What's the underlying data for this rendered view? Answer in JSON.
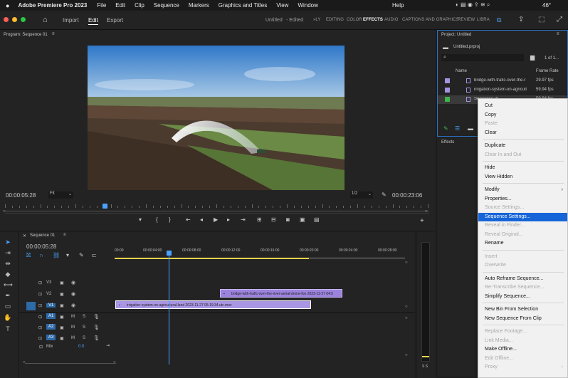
{
  "menubar": {
    "app": "Adobe Premiere Pro 2023",
    "items": [
      "File",
      "Edit",
      "Clip",
      "Sequence",
      "Markers",
      "Graphics and Titles",
      "View",
      "Window"
    ],
    "help": "Help",
    "battery": "46°"
  },
  "appbar": {
    "tabs": [
      "Import",
      "Edit",
      "Export"
    ],
    "active_tab": "Edit",
    "title": "Untitled",
    "edited": "- Edited",
    "workspaces": [
      "»LY",
      "EDITING",
      "COLOR",
      "EFFECTS",
      "AUDIO",
      "CAPTIONS AND GRAPHICS",
      "REVIEW",
      "LIBRA"
    ],
    "active_workspace": "EFFECTS"
  },
  "program": {
    "title": "Program: Sequence 01",
    "timecode_left": "00:00:05:28",
    "fit": "Fit",
    "resolution": "1/2",
    "timecode_right": "00:00:23:06",
    "playhead_fraction": 0.235
  },
  "project": {
    "title": "Project: Untitled",
    "file": "Untitled.prproj",
    "count": "1 of 1...",
    "col_name": "Name",
    "col_rate": "Frame Rate",
    "items": [
      {
        "name": "bridge-with-trafic-over-the-r",
        "rate": "29.97 fps",
        "color": "#a592e0"
      },
      {
        "name": "irrigation-system-on-agricult",
        "rate": "59.94 fps",
        "color": "#a592e0"
      },
      {
        "name": "Sequence 01",
        "rate": "59.94 fps",
        "color": "#3fb54b"
      }
    ]
  },
  "effects": {
    "title": "Effects"
  },
  "timeline": {
    "title": "Sequence 01",
    "timecode": "00:00:05:28",
    "ruler": [
      "00:00",
      "00:00:04:00",
      "00:00:08:00",
      "00:00:12:00",
      "00:00:16:00",
      "00:00:20:00",
      "00:00:24:00",
      "00:00:28:00"
    ],
    "video_tracks": [
      "V3",
      "V2",
      "V1"
    ],
    "audio_tracks": [
      "A1",
      "A2",
      "A3"
    ],
    "mix_label": "Mix",
    "mix_value": "0.0",
    "clip_v2": "bridge-with-trafic-over-the-river-aerial-drone-foo 2023-11-27 04:5",
    "clip_v1": "irrigation-system-on-agricultural-land 2023-11-27 05:19:34.utc.mov"
  },
  "meter": {
    "label": "S S"
  },
  "context_menu": {
    "items": [
      {
        "label": "Cut",
        "disabled": false
      },
      {
        "label": "Copy",
        "disabled": false
      },
      {
        "label": "Paste",
        "disabled": true
      },
      {
        "label": "Clear",
        "disabled": false
      },
      {
        "label": "Duplicate",
        "disabled": false
      },
      {
        "label": "Clear In and Out",
        "disabled": true
      },
      {
        "label": "Hide",
        "disabled": false
      },
      {
        "label": "View Hidden",
        "disabled": false
      },
      {
        "label": "Modify",
        "disabled": false,
        "submenu": true
      },
      {
        "label": "Properties...",
        "disabled": false
      },
      {
        "label": "Source Settings...",
        "disabled": true
      },
      {
        "label": "Sequence Settings...",
        "disabled": false,
        "highlighted": true
      },
      {
        "label": "Reveal in Finder...",
        "disabled": true
      },
      {
        "label": "Reveal Original...",
        "disabled": true
      },
      {
        "label": "Rename",
        "disabled": false
      },
      {
        "label": "Insert",
        "disabled": true
      },
      {
        "label": "Overwrite",
        "disabled": true
      },
      {
        "label": "Auto Reframe Sequence...",
        "disabled": false
      },
      {
        "label": "Re-Transcribe Sequence...",
        "disabled": true
      },
      {
        "label": "Simplify Sequence...",
        "disabled": false
      },
      {
        "label": "New Bin From Selection",
        "disabled": false
      },
      {
        "label": "New Sequence From Clip",
        "disabled": false
      },
      {
        "label": "Replace Footage...",
        "disabled": true
      },
      {
        "label": "Link Media...",
        "disabled": true
      },
      {
        "label": "Make Offline...",
        "disabled": false
      },
      {
        "label": "Edit Offline...",
        "disabled": true
      },
      {
        "label": "Proxy",
        "disabled": true,
        "submenu": true
      }
    ]
  }
}
